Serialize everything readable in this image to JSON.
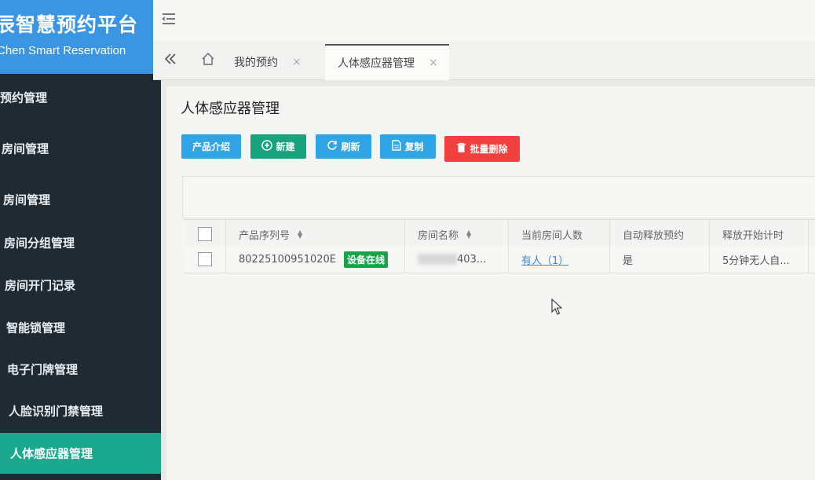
{
  "brand": {
    "title": "辰智慧预约平台",
    "subtitle": "Chen Smart Reservation"
  },
  "sidebar": {
    "items": [
      {
        "label": "预约管理"
      },
      {
        "label": "房间管理"
      },
      {
        "label": "房间管理"
      },
      {
        "label": "房间分组管理"
      },
      {
        "label": "房间开门记录"
      },
      {
        "label": "智能锁管理"
      },
      {
        "label": "电子门牌管理"
      },
      {
        "label": "人脸识别门禁管理"
      },
      {
        "label": "人体感应器管理",
        "active": true
      }
    ]
  },
  "tabs": [
    {
      "label": "我的预约"
    },
    {
      "label": "人体感应器管理",
      "active": true
    }
  ],
  "page": {
    "title": "人体感应器管理"
  },
  "toolbar": {
    "intro_label": "产品介绍",
    "new_label": "新建",
    "refresh_label": "刷新",
    "copy_label": "复制",
    "batch_delete_label": "批量删除"
  },
  "table": {
    "columns": [
      "产品序列号",
      "房间名称",
      "当前房间人数",
      "自动释放预约",
      "释放开始计时"
    ],
    "rows": [
      {
        "serial": "80225100951020E",
        "status_badge": "设备在线",
        "room_name": "403...",
        "people": "有人（1）",
        "auto_release": "是",
        "release_timer": "5分钟无人自..."
      }
    ]
  },
  "colors": {
    "brand_blue": "#3a95e3",
    "sidebar_bg": "#1f2a33",
    "active_green": "#1aa88e",
    "danger_red": "#f0413e",
    "online_green": "#1aa34a"
  }
}
